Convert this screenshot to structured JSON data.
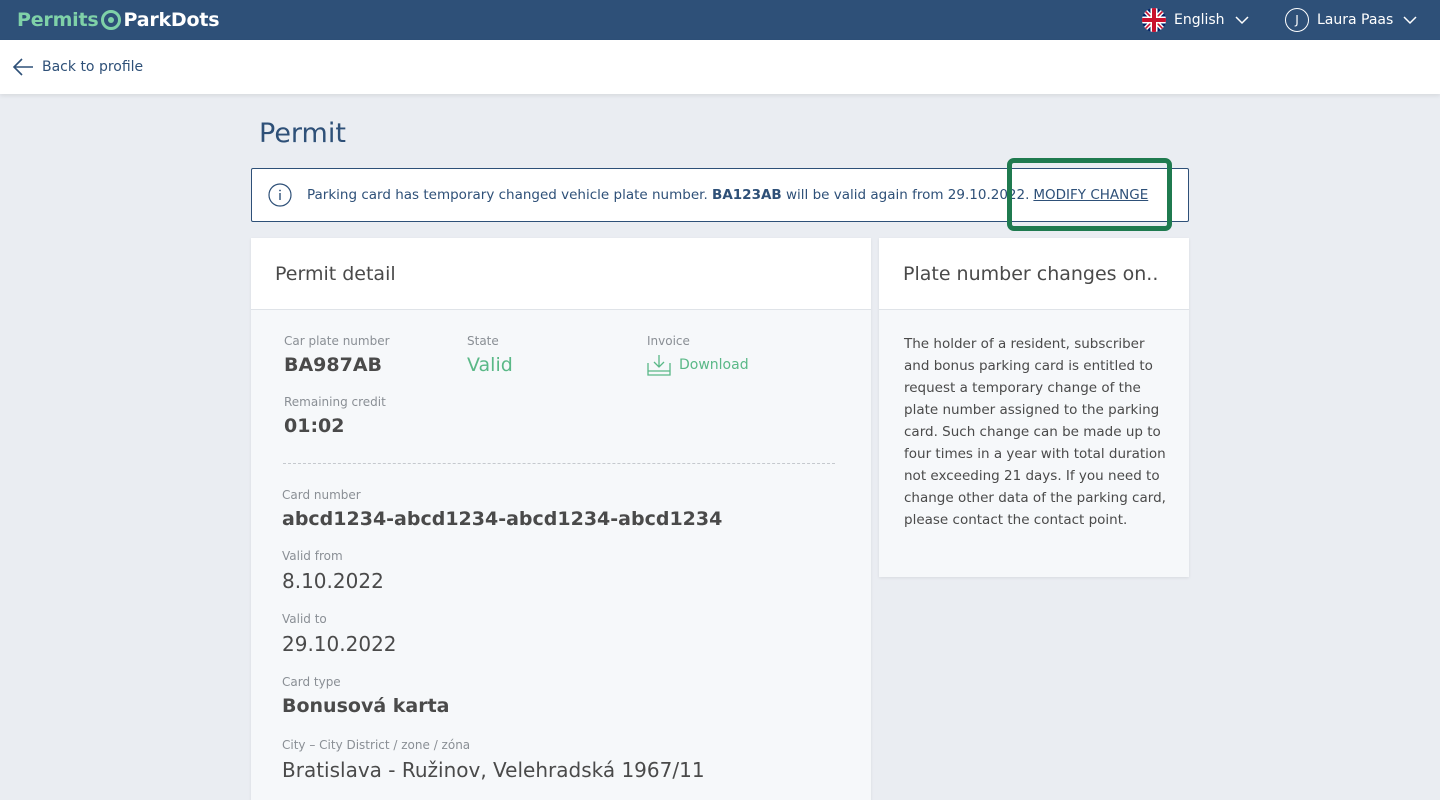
{
  "header": {
    "logo_part1": "Permits",
    "logo_part2": "ParkDots",
    "language": "English",
    "user_initial": "J",
    "user_name": "Laura Paas"
  },
  "nav": {
    "back_label": "Back to profile"
  },
  "page": {
    "title": "Permit"
  },
  "notice": {
    "text_before": "Parking card has temporary changed vehicle plate number.",
    "plate": "BA123AB",
    "text_after": "will be valid again from 29.10.2022.",
    "link": "MODIFY CHANGE"
  },
  "permit_detail": {
    "title": "Permit detail",
    "car_plate_label": "Car plate number",
    "car_plate_value": "BA987AB",
    "state_label": "State",
    "state_value": "Valid",
    "invoice_label": "Invoice",
    "invoice_link": "Download",
    "credit_label": "Remaining credit",
    "credit_value": "01:02",
    "card_number_label": "Card number",
    "card_number_value": "abcd1234-abcd1234-abcd1234-abcd1234",
    "valid_from_label": "Valid from",
    "valid_from_value": "8.10.2022",
    "valid_to_label": "Valid to",
    "valid_to_value": "29.10.2022",
    "card_type_label": "Card type",
    "card_type_value": "Bonusová karta",
    "city_label": "City – City District / zone / zóna",
    "city_value": "Bratislava - Ružinov, Velehradská 1967/11"
  },
  "info_panel": {
    "title": "Plate number changes on..",
    "body": "The holder of a resident, subscriber and bonus parking card is entitled to request a temporary change of the plate number assigned to the parking card. Such change can be made up to four times in a year with total duration not exceeding 21 days. If you need to change other data of the parking card, please contact the contact point."
  },
  "colors": {
    "navy": "#2e5078",
    "green": "#5ab887",
    "highlight": "#1f7a4f",
    "background": "#eaedf2"
  }
}
